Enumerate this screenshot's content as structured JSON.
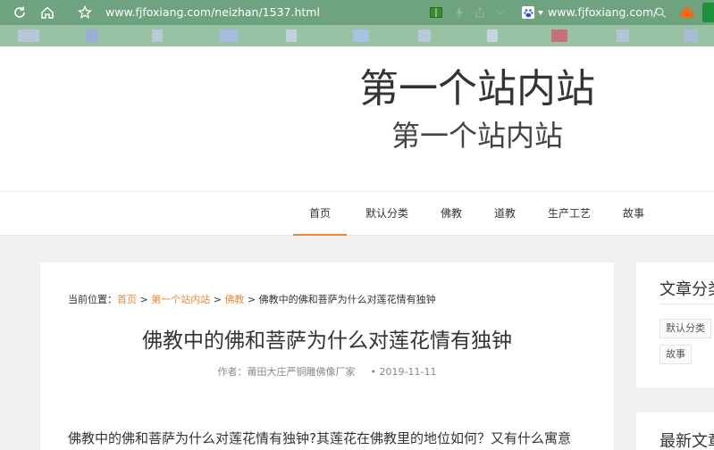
{
  "browser": {
    "url": "www.fjfoxiang.com/neizhan/1537.html",
    "search_url": "www.fjfoxiang.com/"
  },
  "site": {
    "title": "第一个站内站",
    "subtitle": "第一个站内站"
  },
  "nav": {
    "items": [
      {
        "label": "首页"
      },
      {
        "label": "默认分类"
      },
      {
        "label": "佛教"
      },
      {
        "label": "道教"
      },
      {
        "label": "生产工艺"
      },
      {
        "label": "故事"
      }
    ]
  },
  "breadcrumb": {
    "prefix": "当前位置：",
    "home": "首页",
    "sep": " > ",
    "section": "第一个站内站",
    "category": "佛教",
    "current": "佛教中的佛和菩萨为什么对莲花情有独钟"
  },
  "article": {
    "title": "佛教中的佛和菩萨为什么对莲花情有独钟",
    "author": "作者：莆田大庄严铜雕佛像厂家",
    "date": "• 2019-11-11",
    "body_start": "佛教中的佛和菩萨为什么对莲花情有独钟?其莲花在佛教里的地位如何？又有什么寓意"
  },
  "sidebar": {
    "categories_title": "文章分类",
    "tags": [
      "默认分类",
      "故事"
    ],
    "latest_title": "最新文章"
  },
  "colors": {
    "accent": "#e8883b",
    "toolbar": "#6fa27f",
    "bookmarks": "#99c2a5"
  }
}
